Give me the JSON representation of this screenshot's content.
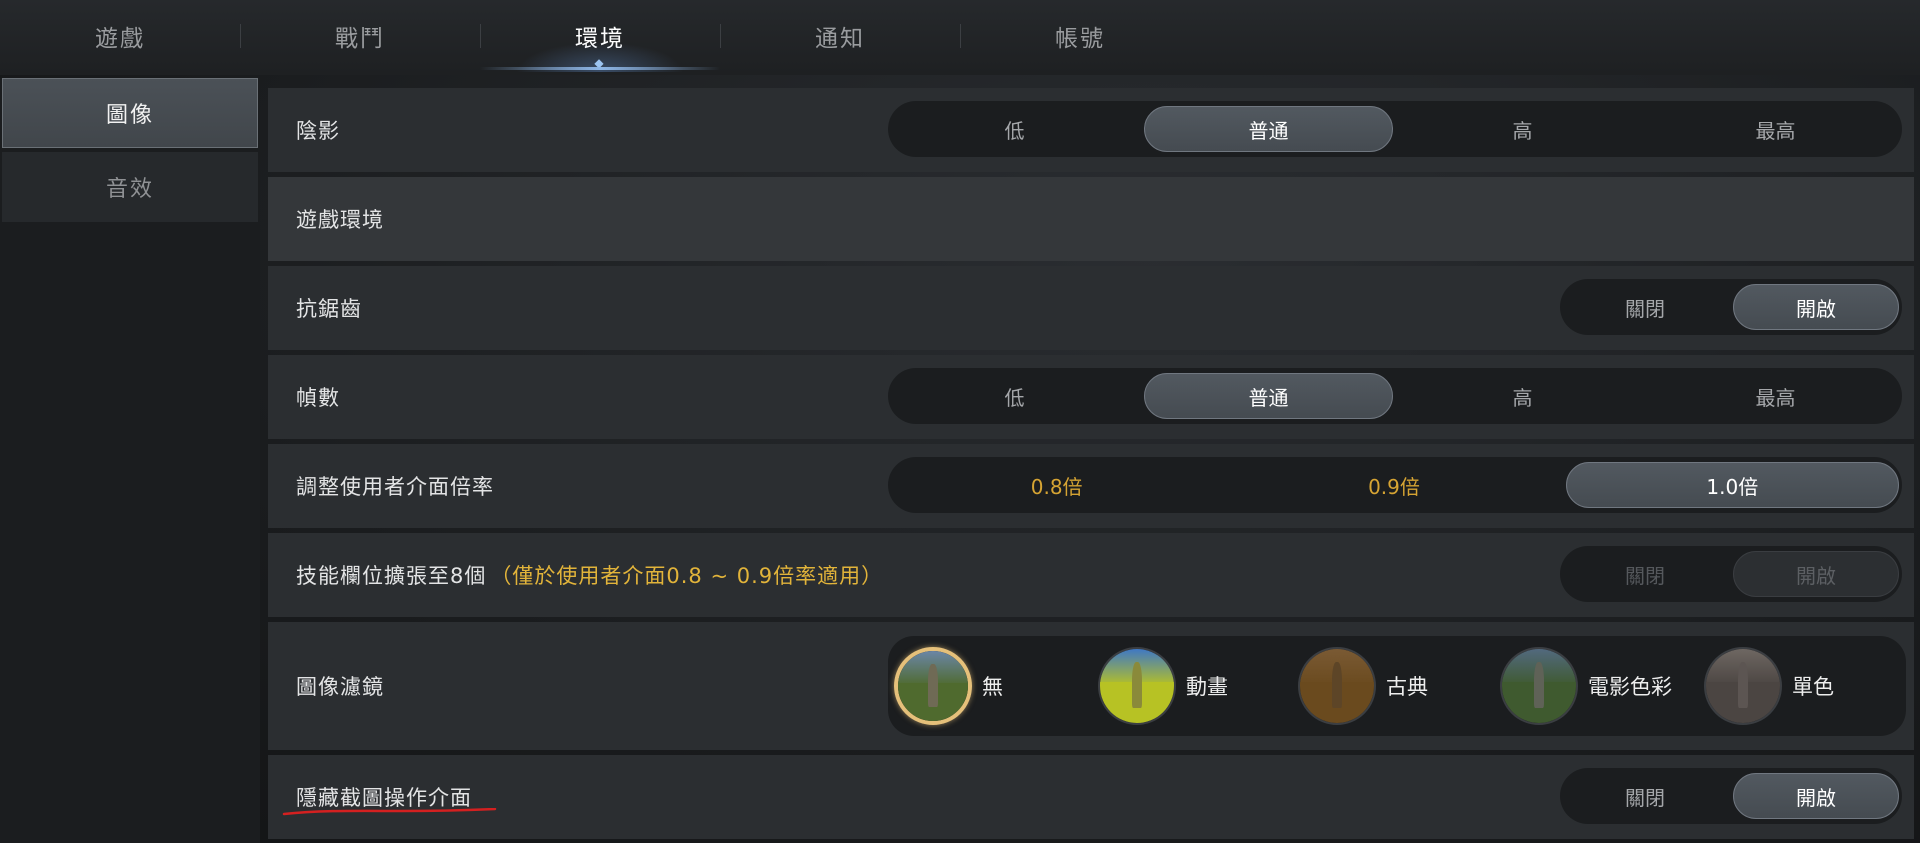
{
  "tabs": [
    {
      "label": "遊戲",
      "active": false
    },
    {
      "label": "戰鬥",
      "active": false
    },
    {
      "label": "環境",
      "active": true
    },
    {
      "label": "通知",
      "active": false
    },
    {
      "label": "帳號",
      "active": false
    }
  ],
  "sidebar": {
    "items": [
      {
        "label": "圖像",
        "active": true
      },
      {
        "label": "音效",
        "active": false
      }
    ]
  },
  "settings": {
    "shadow": {
      "label": "陰影",
      "options": [
        "低",
        "普通",
        "高",
        "最高"
      ],
      "selected": "普通"
    },
    "section_header": {
      "label": "遊戲環境"
    },
    "antialias": {
      "label": "抗鋸齒",
      "options": [
        "關閉",
        "開啟"
      ],
      "selected": "開啟"
    },
    "framerate": {
      "label": "幀數",
      "options": [
        "低",
        "普通",
        "高",
        "最高"
      ],
      "selected": "普通"
    },
    "ui_scale": {
      "label": "調整使用者介面倍率",
      "options": [
        "0.8倍",
        "0.9倍",
        "1.0倍"
      ],
      "selected": "1.0倍"
    },
    "skill_slots": {
      "label": "技能欄位擴張至8個",
      "note": "（僅於使用者介面0.8 ~ 0.9倍率適用）",
      "options": [
        "關閉",
        "開啟"
      ],
      "selected": "開啟",
      "disabled": true
    },
    "image_filter": {
      "label": "圖像濾鏡",
      "options": [
        {
          "label": "無",
          "selected": true,
          "sky": "#6b86a6",
          "land": "#4f6a2e",
          "stone": "#6f6a55"
        },
        {
          "label": "動畫",
          "selected": false,
          "sky": "#3f78c4",
          "land": "#b7c224",
          "stone": "#8a8a3a"
        },
        {
          "label": "古典",
          "selected": false,
          "sky": "#7a5a34",
          "land": "#6a4a1e",
          "stone": "#5d4527"
        },
        {
          "label": "電影色彩",
          "selected": false,
          "sky": "#52697e",
          "land": "#3f5a2f",
          "stone": "#5f6257"
        },
        {
          "label": "單色",
          "selected": false,
          "sky": "#6e6762",
          "land": "#4b4542",
          "stone": "#5c5552"
        }
      ]
    },
    "hide_screenshot_ui": {
      "label": "隱藏截圖操作介面",
      "options": [
        "關閉",
        "開啟"
      ],
      "selected": "開啟"
    }
  },
  "colors": {
    "accent_gold": "#e2b43a",
    "annotation_red": "#d42020",
    "active_tab_glow": "#8fb7e6"
  }
}
